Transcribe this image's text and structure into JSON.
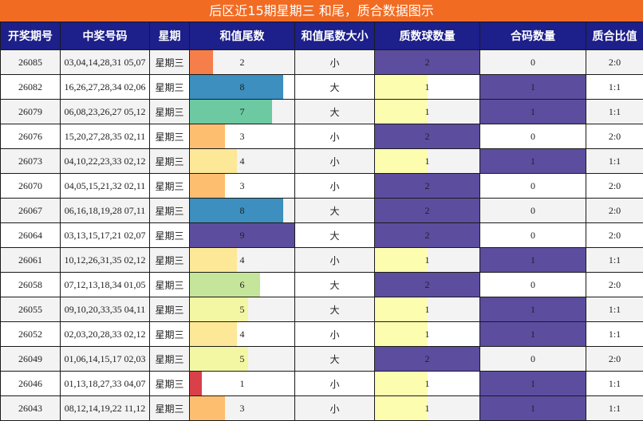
{
  "title": "后区近15期星期三 和尾，质合数据图示",
  "headers": [
    "开奖期号",
    "中奖号码",
    "星期",
    "和值尾数",
    "和值尾数大小",
    "质数球数量",
    "合码数量",
    "质合比值"
  ],
  "colors": {
    "title_bg": "#f26b22",
    "header_bg": "#1d1f8a",
    "count_two": "#5c4d9f",
    "count_one": "#fdfdb0",
    "digit_colors": {
      "1": "#d8414a",
      "2": "#f57e4a",
      "3": "#fdbf6f",
      "4": "#fde898",
      "5": "#f3f7a4",
      "6": "#c5e69a",
      "7": "#6cc9a2",
      "8": "#3c8fbe",
      "9": "#5c4d9f"
    }
  },
  "rows": [
    {
      "issue": "26085",
      "numbers": "03,04,14,28,31 05,07",
      "weekday": "星期三",
      "tail": 2,
      "size": "小",
      "prime": 2,
      "composite": 0,
      "ratio": "2:0"
    },
    {
      "issue": "26082",
      "numbers": "16,26,27,28,34 02,06",
      "weekday": "星期三",
      "tail": 8,
      "size": "大",
      "prime": 1,
      "composite": 1,
      "ratio": "1:1"
    },
    {
      "issue": "26079",
      "numbers": "06,08,23,26,27 05,12",
      "weekday": "星期三",
      "tail": 7,
      "size": "大",
      "prime": 1,
      "composite": 1,
      "ratio": "1:1"
    },
    {
      "issue": "26076",
      "numbers": "15,20,27,28,35 02,11",
      "weekday": "星期三",
      "tail": 3,
      "size": "小",
      "prime": 2,
      "composite": 0,
      "ratio": "2:0"
    },
    {
      "issue": "26073",
      "numbers": "04,10,22,23,33 02,12",
      "weekday": "星期三",
      "tail": 4,
      "size": "小",
      "prime": 1,
      "composite": 1,
      "ratio": "1:1"
    },
    {
      "issue": "26070",
      "numbers": "04,05,15,21,32 02,11",
      "weekday": "星期三",
      "tail": 3,
      "size": "小",
      "prime": 2,
      "composite": 0,
      "ratio": "2:0"
    },
    {
      "issue": "26067",
      "numbers": "06,16,18,19,28 07,11",
      "weekday": "星期三",
      "tail": 8,
      "size": "大",
      "prime": 2,
      "composite": 0,
      "ratio": "2:0"
    },
    {
      "issue": "26064",
      "numbers": "03,13,15,17,21 02,07",
      "weekday": "星期三",
      "tail": 9,
      "size": "大",
      "prime": 2,
      "composite": 0,
      "ratio": "2:0"
    },
    {
      "issue": "26061",
      "numbers": "10,12,26,31,35 02,12",
      "weekday": "星期三",
      "tail": 4,
      "size": "小",
      "prime": 1,
      "composite": 1,
      "ratio": "1:1"
    },
    {
      "issue": "26058",
      "numbers": "07,12,13,18,34 01,05",
      "weekday": "星期三",
      "tail": 6,
      "size": "大",
      "prime": 2,
      "composite": 0,
      "ratio": "2:0"
    },
    {
      "issue": "26055",
      "numbers": "09,10,20,33,35 04,11",
      "weekday": "星期三",
      "tail": 5,
      "size": "大",
      "prime": 1,
      "composite": 1,
      "ratio": "1:1"
    },
    {
      "issue": "26052",
      "numbers": "02,03,20,28,33 02,12",
      "weekday": "星期三",
      "tail": 4,
      "size": "小",
      "prime": 1,
      "composite": 1,
      "ratio": "1:1"
    },
    {
      "issue": "26049",
      "numbers": "01,06,14,15,17 02,03",
      "weekday": "星期三",
      "tail": 5,
      "size": "大",
      "prime": 2,
      "composite": 0,
      "ratio": "2:0"
    },
    {
      "issue": "26046",
      "numbers": "01,13,18,27,33 04,07",
      "weekday": "星期三",
      "tail": 1,
      "size": "小",
      "prime": 1,
      "composite": 1,
      "ratio": "1:1"
    },
    {
      "issue": "26043",
      "numbers": "08,12,14,19,22 11,12",
      "weekday": "星期三",
      "tail": 3,
      "size": "小",
      "prime": 1,
      "composite": 1,
      "ratio": "1:1"
    }
  ]
}
